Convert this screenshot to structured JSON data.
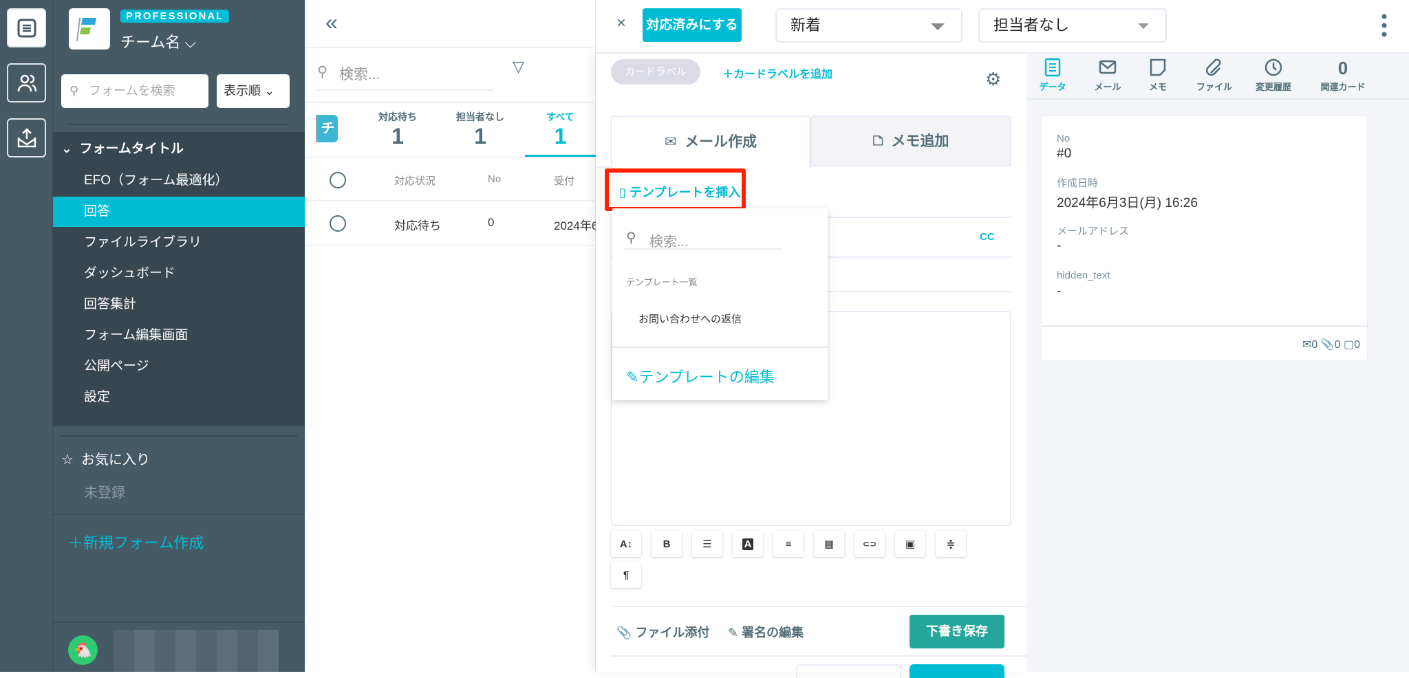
{
  "sidebar": {
    "plan_badge": "PROFESSIONAL",
    "team_name": "チーム名",
    "search_placeholder": "フォームを検索",
    "sort_label": "表示順",
    "form_title": "フォームタイトル",
    "items": [
      {
        "label": "EFO（フォーム最適化）"
      },
      {
        "label": "回答"
      },
      {
        "label": "ファイルライブラリ"
      },
      {
        "label": "ダッシュボード"
      },
      {
        "label": "回答集計"
      },
      {
        "label": "フォーム編集画面"
      },
      {
        "label": "公開ページ"
      },
      {
        "label": "設定"
      }
    ],
    "favorites_label": "お気に入り",
    "favorites_empty": "未登録",
    "new_form": "新規フォーム作成"
  },
  "list": {
    "search_placeholder": "検索...",
    "flag_letter": "チ",
    "tabs": [
      {
        "label": "対応待ち",
        "count": "1"
      },
      {
        "label": "担当者なし",
        "count": "1"
      },
      {
        "label": "すべて",
        "count": "1"
      }
    ],
    "columns": [
      "対応状況",
      "No",
      "受付"
    ],
    "rows": [
      {
        "status": "対応待ち",
        "no": "0",
        "received": "2024年6"
      }
    ]
  },
  "detail": {
    "resolve_button": "対応済みにする",
    "status_select": "新着",
    "assignee_select": "担当者なし",
    "card_label": "カードラベル",
    "add_card_label": "＋カードラベルを追加",
    "tabs": [
      "メール作成",
      "メモ追加"
    ],
    "insert_template": "テンプレートを挿入",
    "cc": "CC",
    "template_menu": {
      "search_placeholder": "検索...",
      "section": "テンプレート一覧",
      "items": [
        "お問い合わせへの返信"
      ],
      "edit": "テンプレートの編集"
    },
    "toolbar": [
      "A↕",
      "B",
      "☰",
      "A",
      "≡",
      "▦",
      "⊂⊃",
      "▣",
      "≑",
      "¶"
    ],
    "attach": "ファイル添付",
    "signature": "署名の編集",
    "save_draft": "下書き保存"
  },
  "right": {
    "tabs": [
      {
        "label": "データ"
      },
      {
        "label": "メール"
      },
      {
        "label": "メモ"
      },
      {
        "label": "ファイル"
      },
      {
        "label": "変更履歴"
      },
      {
        "label": "関連カード",
        "count": "0"
      }
    ],
    "fields": [
      {
        "label": "No",
        "value": "#0"
      },
      {
        "label": "作成日時",
        "value": "2024年6月3日(月) 16:26"
      },
      {
        "label": "メールアドレス",
        "value": "-"
      },
      {
        "label": "hidden_text",
        "value": "-"
      }
    ],
    "footer": {
      "mail": "0",
      "file": "0",
      "memo": "0"
    }
  },
  "colors": {
    "accent": "#00bcd4",
    "sidebar": "#465a66",
    "sidebar_dark": "#37474f",
    "save": "#26a69a",
    "highlight": "#ff2200"
  }
}
